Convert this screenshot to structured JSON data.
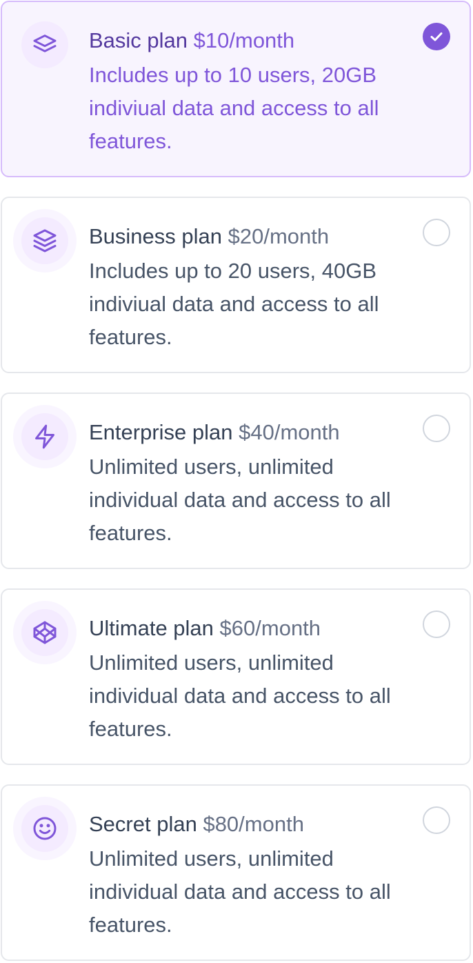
{
  "colors": {
    "accent": "#7f56d9",
    "accent_dark": "#53389e",
    "selected_bg": "#f8f4fe",
    "selected_border": "#d6bbfb",
    "border": "#e5e7eb",
    "text_primary": "#344054",
    "text_secondary": "#475467"
  },
  "plans": [
    {
      "name": "Basic plan",
      "price": "$10/month",
      "description": "Includes up to 10 users, 20GB indiviual data and access to all features.",
      "icon": "layers-two-icon",
      "selected": true
    },
    {
      "name": "Business plan",
      "price": "$20/month",
      "description": "Includes up to 20 users, 40GB indiviual data and access to all features.",
      "icon": "layers-three-icon",
      "selected": false
    },
    {
      "name": "Enterprise plan",
      "price": "$40/month",
      "description": "Unlimited users, unlimited individual data and access to all features.",
      "icon": "zap-icon",
      "selected": false
    },
    {
      "name": "Ultimate plan",
      "price": "$60/month",
      "description": "Unlimited users, unlimited individual data and access to all features.",
      "icon": "codepen-icon",
      "selected": false
    },
    {
      "name": "Secret plan",
      "price": "$80/month",
      "description": "Unlimited users, unlimited individual data and access to all features.",
      "icon": "face-smile-icon",
      "selected": false
    }
  ]
}
